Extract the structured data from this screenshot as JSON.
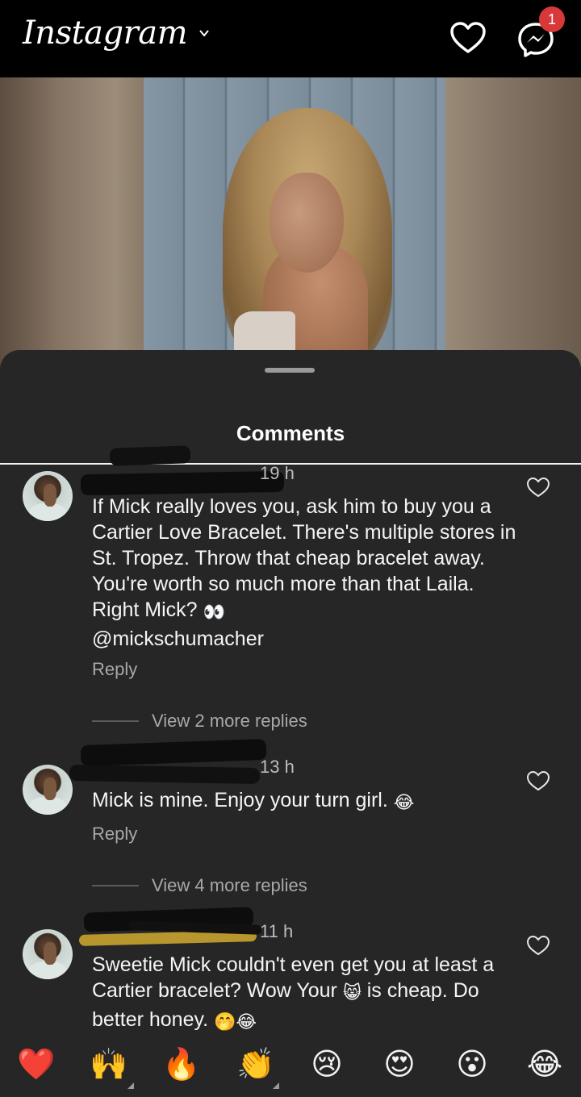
{
  "header": {
    "app_name": "Instagram",
    "notification_count": "1"
  },
  "sheet": {
    "title": "Comments"
  },
  "comments": [
    {
      "time": "19 h",
      "text": "If Mick really loves you, ask him to buy you a Cartier Love Bracelet. There's multiple stores in St. Tropez. Throw that cheap bracelet away. You're worth so much more than that Laila. Right Mick? ",
      "emoji": "👀",
      "mention": "@mickschumacher",
      "reply_label": "Reply",
      "more_replies": "View 2 more replies"
    },
    {
      "time": "13 h",
      "text": "Mick is mine. Enjoy your turn girl. ",
      "emoji": "😂",
      "reply_label": "Reply",
      "more_replies": "View 4 more replies"
    },
    {
      "time": "11 h",
      "text_a": "Sweetie Mick couldn't even get you at least a Cartier bracelet? Wow Your ",
      "emoji_a": "😸",
      "text_b": " is cheap. Do better honey. ",
      "emoji_b": "🤭😂"
    }
  ],
  "emoji_bar": [
    "❤️",
    "🙌",
    "🔥",
    "👏",
    "😢",
    "😍",
    "😮",
    "😂"
  ],
  "colors": {
    "background": "#000000",
    "sheet": "#262626",
    "badge": "#d9383a",
    "secondary_text": "#a8a8a8"
  }
}
